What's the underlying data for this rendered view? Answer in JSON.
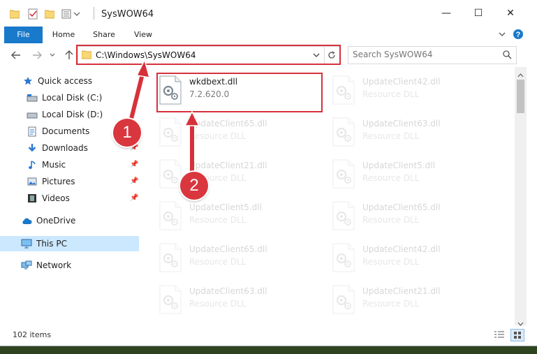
{
  "window": {
    "title": "SysWOW64",
    "controls": {
      "minimize": "—",
      "maximize": "☐",
      "close": "✕"
    }
  },
  "ribbon": {
    "tabs": [
      {
        "label": "File"
      },
      {
        "label": "Home"
      },
      {
        "label": "Share"
      },
      {
        "label": "View"
      }
    ]
  },
  "navigation": {
    "address": "C:\\Windows\\SysWOW64",
    "search_placeholder": "Search SysWOW64"
  },
  "sidebar": {
    "items": [
      {
        "label": "Quick access"
      },
      {
        "label": "Local Disk (C:)"
      },
      {
        "label": "Local Disk (D:)"
      },
      {
        "label": "Documents"
      },
      {
        "label": "Downloads"
      },
      {
        "label": "Music"
      },
      {
        "label": "Pictures"
      },
      {
        "label": "Videos"
      },
      {
        "label": "OneDrive"
      },
      {
        "label": "This PC"
      },
      {
        "label": "Network"
      }
    ]
  },
  "files": [
    {
      "name": "wkdbext.dll",
      "subtitle": "7.2.620.0",
      "faded": false
    },
    {
      "name": "UpdateClient42.dll",
      "subtitle": "Resource DLL",
      "faded": true
    },
    {
      "name": "UpdateClient65.dll",
      "subtitle": "Resource DLL",
      "faded": true
    },
    {
      "name": "UpdateClient63.dll",
      "subtitle": "Resource DLL",
      "faded": true
    },
    {
      "name": "UpdateClient21.dll",
      "subtitle": "Resource DLL",
      "faded": true
    },
    {
      "name": "UpdateClient5.dll",
      "subtitle": "Resource DLL",
      "faded": true
    },
    {
      "name": "UpdateClient5.dll",
      "subtitle": "Resource DLL",
      "faded": true
    },
    {
      "name": "UpdateClient65.dll",
      "subtitle": "Resource DLL",
      "faded": true
    },
    {
      "name": "UpdateClient65.dll",
      "subtitle": "Resource DLL",
      "faded": true
    },
    {
      "name": "UpdateClient42.dll",
      "subtitle": "Resource DLL",
      "faded": true
    },
    {
      "name": "UpdateClient63.dll",
      "subtitle": "Resource DLL",
      "faded": true
    },
    {
      "name": "UpdateClient21.dll",
      "subtitle": "Resource DLL",
      "faded": true
    }
  ],
  "status": {
    "item_count": "102 items"
  },
  "annotations": {
    "step1": "1",
    "step2": "2"
  },
  "colors": {
    "accent": "#1979ca",
    "highlight": "#d6313a",
    "selection": "#cce8ff"
  }
}
